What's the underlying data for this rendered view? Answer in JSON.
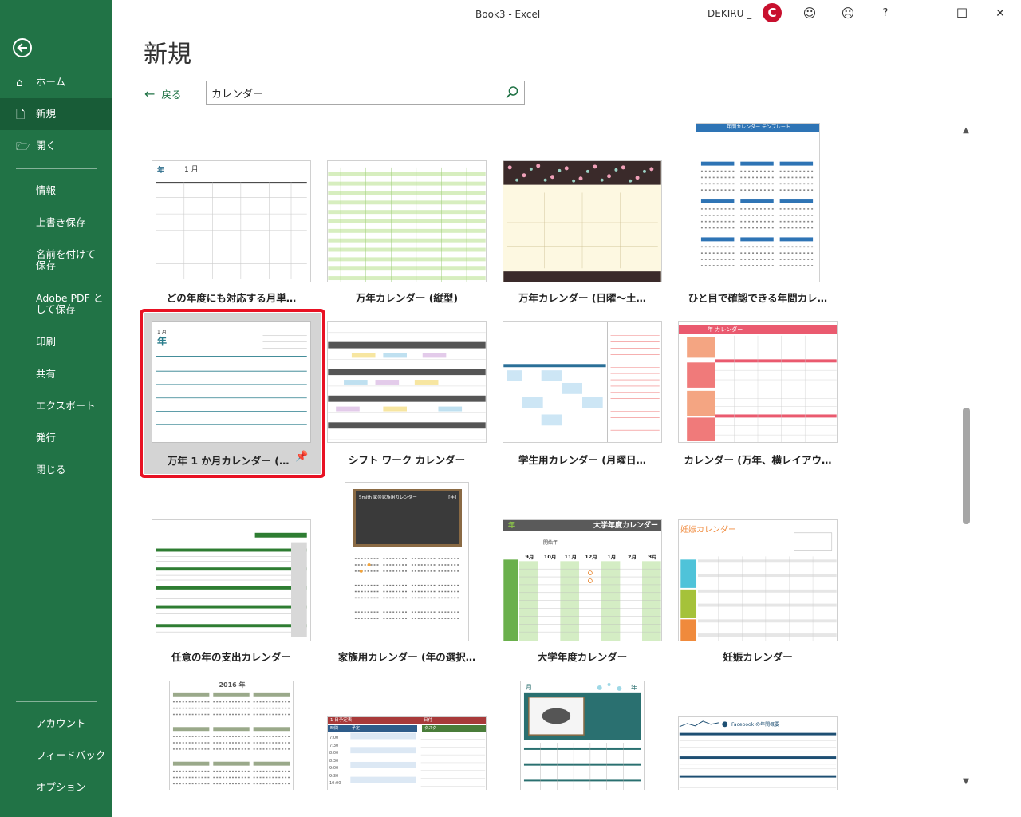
{
  "window": {
    "title": "Book3  -  Excel",
    "user": "DEKIRU _",
    "avatar_letter": "C"
  },
  "titlebar_icons": [
    "smile-icon",
    "frown-icon",
    "help-icon",
    "minimize-icon",
    "maximize-icon",
    "close-icon"
  ],
  "titlebar_glyphs": {
    "smile": "☺",
    "frown": "☹",
    "help": "?",
    "minimize": "—",
    "maximize": "☐",
    "close": "✕"
  },
  "sidebar": {
    "home": "ホーム",
    "new": "新規",
    "open": "開く",
    "info": "情報",
    "save": "上書き保存",
    "save_as": "名前を付けて保存",
    "adobe": "Adobe PDF として保存",
    "print": "印刷",
    "share": "共有",
    "export": "エクスポート",
    "publish": "発行",
    "close": "閉じる",
    "account": "アカウント",
    "feedback": "フィードバック",
    "options": "オプション"
  },
  "main": {
    "title": "新規",
    "back_label": "戻る",
    "search_value": "カレンダー"
  },
  "templates": [
    "どの年度にも対応する月単…",
    "万年カレンダー (縦型)",
    "万年カレンダー (日曜～土…",
    "ひと目で確認できる年間カレ…",
    "万年 1 か月カレンダー (メモ…",
    "シフト ワーク カレンダー",
    "学生用カレンダー (月曜日…",
    "カレンダー (万年、横レイアウ…",
    "任意の年の支出カレンダー",
    "家族用カレンダー (年の選択…",
    "大学年度カレンダー",
    "妊娠カレンダー"
  ],
  "thumb_text": {
    "t1_year": "年",
    "t1_month": "1 月",
    "t4_header": "年間カレンダー テンプレート",
    "t5_month": "1 月",
    "t5_year": "年",
    "t8_header": "年 カレンダー",
    "t10_header": "Smith 家の家族用カレンダー",
    "t10_year": "[年]",
    "t11_year": "年",
    "t11_header": "大学年度カレンダー",
    "t11_start": "開始年",
    "t11_months": [
      "9月",
      "10月",
      "11月",
      "12月",
      "1月",
      "2月",
      "3月"
    ],
    "t12_header": "妊娠カレンダー",
    "t13_header": "2016 年",
    "t14_header": "1 日予定表",
    "t14_date": "日付",
    "t14_col1": "時間",
    "t14_col2": "予定",
    "t14_col3": "タスク",
    "t14_times": [
      "7:00",
      "7:30",
      "8:00",
      "8:30",
      "9:00",
      "9:30",
      "10:00"
    ],
    "t15_month": "月",
    "t15_year": "年",
    "t16_header": "Facebook の年間概要"
  },
  "colors": {
    "excel_green": "#217346",
    "highlight_red": "#e81123"
  }
}
